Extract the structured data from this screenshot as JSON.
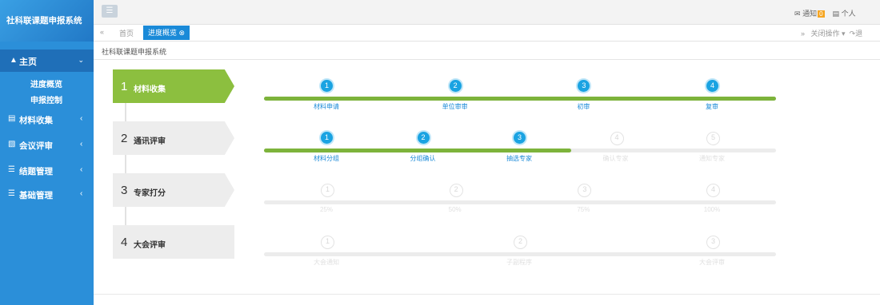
{
  "app": {
    "title": "社科联课题申报系统"
  },
  "sidebar": {
    "home": {
      "label": "主页",
      "icon": "home-icon"
    },
    "home_sub": [
      {
        "label": "进度概览"
      },
      {
        "label": "申报控制"
      }
    ],
    "items": [
      {
        "label": "材料收集",
        "icon": "file-icon"
      },
      {
        "label": "会议评审",
        "icon": "card-icon"
      },
      {
        "label": "结题管理",
        "icon": "list-icon"
      },
      {
        "label": "基础管理",
        "icon": "list-icon"
      }
    ]
  },
  "topbar": {
    "notify_label": "通知",
    "notify_count": "0",
    "personal_label": "个人"
  },
  "tabs": {
    "home": "首页",
    "active": "进度概览",
    "close_ops": "关闭操作",
    "exit": "退"
  },
  "breadcrumb": "社科联课题申报系统",
  "stages": [
    {
      "num": "1",
      "label": "材料收集",
      "active": true,
      "progress": 1.0,
      "steps": [
        {
          "n": "1",
          "label": "材料申请",
          "done": true
        },
        {
          "n": "2",
          "label": "单位审审",
          "done": true
        },
        {
          "n": "3",
          "label": "初审",
          "done": true
        },
        {
          "n": "4",
          "label": "复审",
          "done": true
        }
      ]
    },
    {
      "num": "2",
      "label": "通讯评审",
      "active": false,
      "progress": 0.6,
      "steps": [
        {
          "n": "1",
          "label": "材料分组",
          "done": true
        },
        {
          "n": "2",
          "label": "分组确认",
          "done": true
        },
        {
          "n": "3",
          "label": "抽选专家",
          "done": true
        },
        {
          "n": "4",
          "label": "确认专家",
          "done": false
        },
        {
          "n": "5",
          "label": "通知专家",
          "done": false
        }
      ]
    },
    {
      "num": "3",
      "label": "专家打分",
      "active": false,
      "progress": 0,
      "steps": [
        {
          "n": "1",
          "label": "25%",
          "done": false
        },
        {
          "n": "2",
          "label": "50%",
          "done": false
        },
        {
          "n": "3",
          "label": "75%",
          "done": false
        },
        {
          "n": "4",
          "label": "100%",
          "done": false
        }
      ]
    },
    {
      "num": "4",
      "label": "大会评审",
      "active": false,
      "progress": 0,
      "steps": [
        {
          "n": "1",
          "label": "大会通知",
          "done": false
        },
        {
          "n": "2",
          "label": "子副程序",
          "done": false
        },
        {
          "n": "3",
          "label": "大会评审",
          "done": false
        }
      ]
    }
  ],
  "colors": {
    "sidebar": "#2b8fd9",
    "tab_active": "#1a8ad8",
    "stage_active": "#8cbf3f",
    "stage_inactive": "#ededed",
    "progress": "#7db33b",
    "circle_done": "#1aa3e2"
  }
}
